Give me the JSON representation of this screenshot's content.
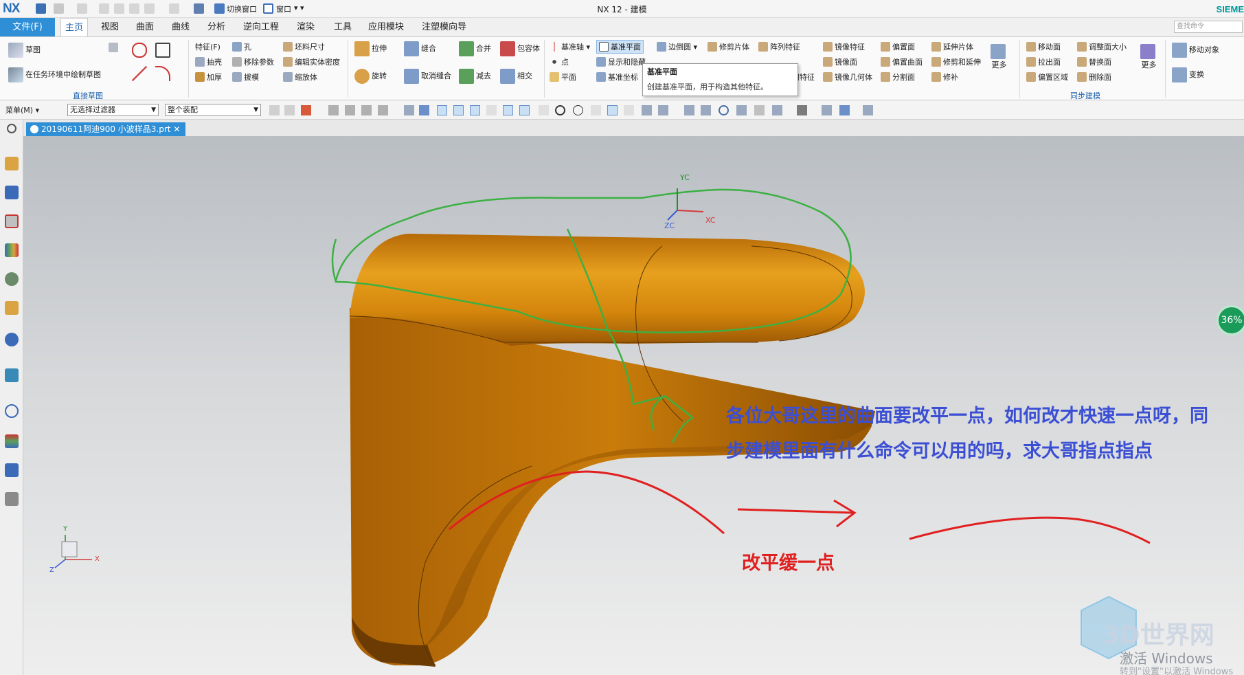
{
  "window": {
    "logo": "NX",
    "title": "NX 12 - 建模",
    "brand": "SIEME",
    "quick_switch": "切换窗口",
    "quick_window": "窗口"
  },
  "tabs": {
    "file": "文件(F)",
    "items": [
      "主页",
      "视图",
      "曲面",
      "曲线",
      "分析",
      "逆向工程",
      "渲染",
      "工具",
      "应用模块",
      "注塑模向导"
    ],
    "search_placeholder": "查找命令"
  },
  "ribbon": {
    "sketch": "草图",
    "sketch_in_task": "在任务环境中绘制草图",
    "direct_sketch_label": "直接草图",
    "feature": "特征(F)",
    "hole": "孔",
    "rough_size": "坯料尺寸",
    "shell": "抽壳",
    "remove_params": "移除参数",
    "edit_solid_density": "编辑实体密度",
    "thicken": "加厚",
    "draft": "拔模",
    "scale_body": "缩放体",
    "extrude": "拉伸",
    "sew": "缝合",
    "unite": "合并",
    "wrap_body": "包容体",
    "revolve": "旋转",
    "unsew": "取消缝合",
    "subtract": "减去",
    "intersect": "相交",
    "datum_axis": "基准轴",
    "point": "点",
    "plane": "平面",
    "datum_plane": "基准平面",
    "show_hide": "显示和隐藏",
    "datum_csys": "基准坐标",
    "edge_blend": "边倒圆",
    "trim_body": "修剪片体",
    "pattern_feature": "阵列特征",
    "pattern_geom": "几何特征",
    "mirror_feature": "镜像特征",
    "offset_face": "偏置面",
    "extend_sheet": "延伸片体",
    "mirror_face": "镜像面",
    "offset_surface": "偏置曲面",
    "trim_extend": "修剪和延伸",
    "mirror_geom": "镜像几何体",
    "divide_face": "分割面",
    "patch": "修补",
    "more": "更多",
    "move_face": "移动面",
    "resize_face": "调整面大小",
    "pull_face": "拉出面",
    "replace_face": "替换面",
    "offset_region": "偏置区域",
    "delete_face": "删除面",
    "sync_label": "同步建模",
    "move_object": "移动对象",
    "transform": "变换",
    "tooltip_title": "基准平面",
    "tooltip_desc": "创建基准平面，用于构造其他特征。"
  },
  "selection_bar": {
    "menu": "菜单(M)",
    "filter": "无选择过滤器",
    "scope": "整个装配"
  },
  "document": {
    "tab": "20190611阿迪900 小波样品3.prt"
  },
  "viewport": {
    "axis_yc": "YC",
    "axis_xc": "XC",
    "axis_zc": "ZC",
    "triad_y": "Y",
    "triad_x": "X",
    "triad_z": "Z",
    "zoom_badge": "36%",
    "question": "各位大哥这里的曲面要改平一点，如何改才快速一点呀，同步建模里面有什么命令可以用的吗，求大哥指点指点",
    "annotation": "改平缓一点",
    "watermark": "3D世界网",
    "activate": "激活 Windows",
    "activate_hint": "转到\"设置\"以激活 Windows"
  },
  "colors": {
    "accent": "#2f8fd6",
    "part": "#d9870c",
    "question_text": "#3b4fd4",
    "annotation": "#e02020",
    "sketch_green": "#3cb043"
  }
}
